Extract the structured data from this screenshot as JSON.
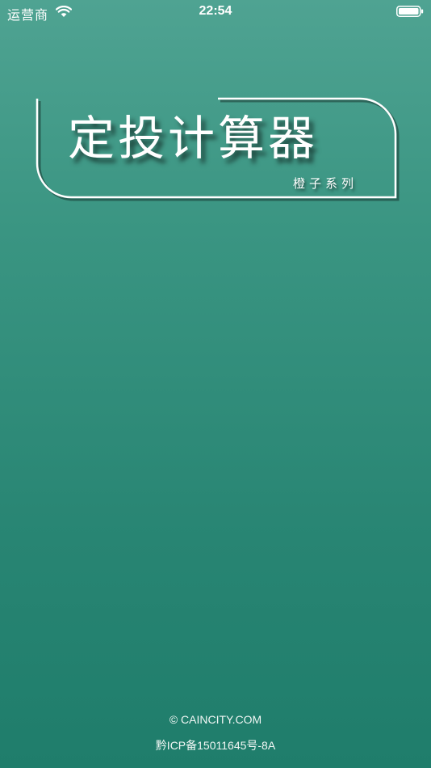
{
  "status_bar": {
    "carrier": "运营商",
    "time": "22:54",
    "icons": [
      "wifi-icon",
      "battery-icon"
    ]
  },
  "logo": {
    "title": "定投计算器",
    "subtitle": "橙子系列"
  },
  "footer": {
    "copyright": "© CAINCITY.COM",
    "icp": "黔ICP备15011645号-8A"
  },
  "colors": {
    "gradient_top": "#4fa392",
    "gradient_bottom": "#1f7d6b",
    "text": "#ffffff"
  }
}
